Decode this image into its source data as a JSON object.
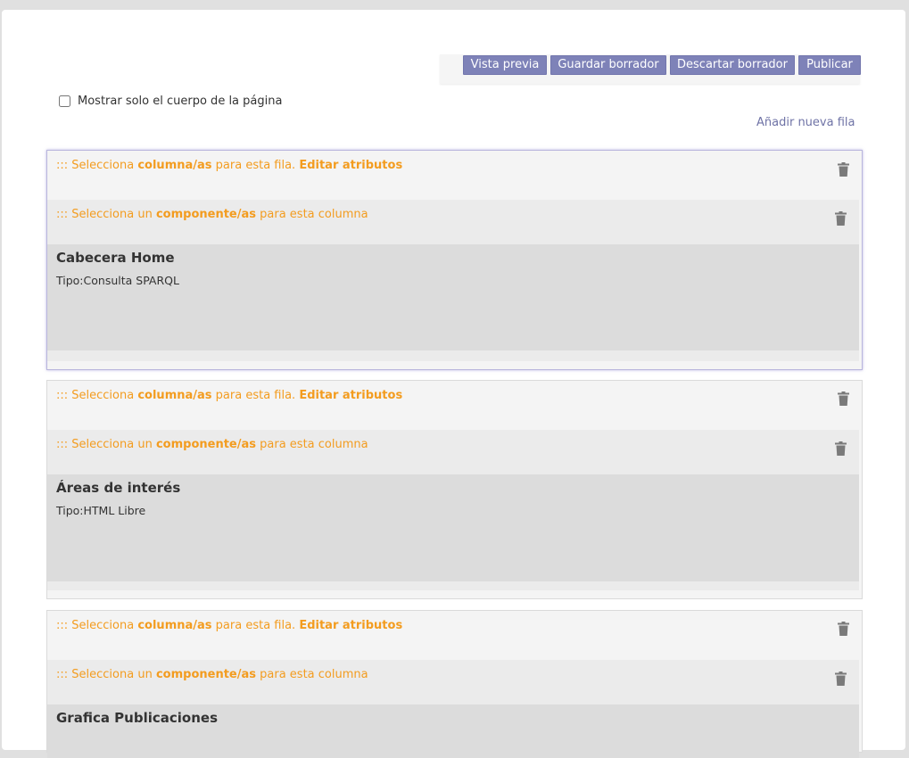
{
  "toolbar": {
    "preview_label": "Vista previa",
    "save_label": "Guardar borrador",
    "discard_label": "Descartar borrador",
    "publish_label": "Publicar",
    "button_color": "#7e82b8"
  },
  "options": {
    "body_only_label": "Mostrar solo el cuerpo de la página",
    "body_only_checked": false
  },
  "add_row_label": "Añadir nueva fila",
  "row_header": {
    "prefix": "::: Selecciona ",
    "strong": "columna/as",
    "middle": " para esta fila. ",
    "edit": "Editar atributos"
  },
  "column_header": {
    "prefix": "::: Selecciona un ",
    "strong": "componente/as",
    "suffix": " para esta columna"
  },
  "rows": [
    {
      "component_title": "Cabecera Home",
      "component_type": "Tipo:Consulta SPARQL",
      "selected": true
    },
    {
      "component_title": "Áreas de interés",
      "component_type": "Tipo:HTML Libre",
      "selected": false
    },
    {
      "component_title": "Grafica Publicaciones",
      "component_type": "",
      "selected": false
    }
  ],
  "colors": {
    "accent": "#f39c1f",
    "link": "#6f73a6",
    "trash": "#7a7a7a"
  }
}
